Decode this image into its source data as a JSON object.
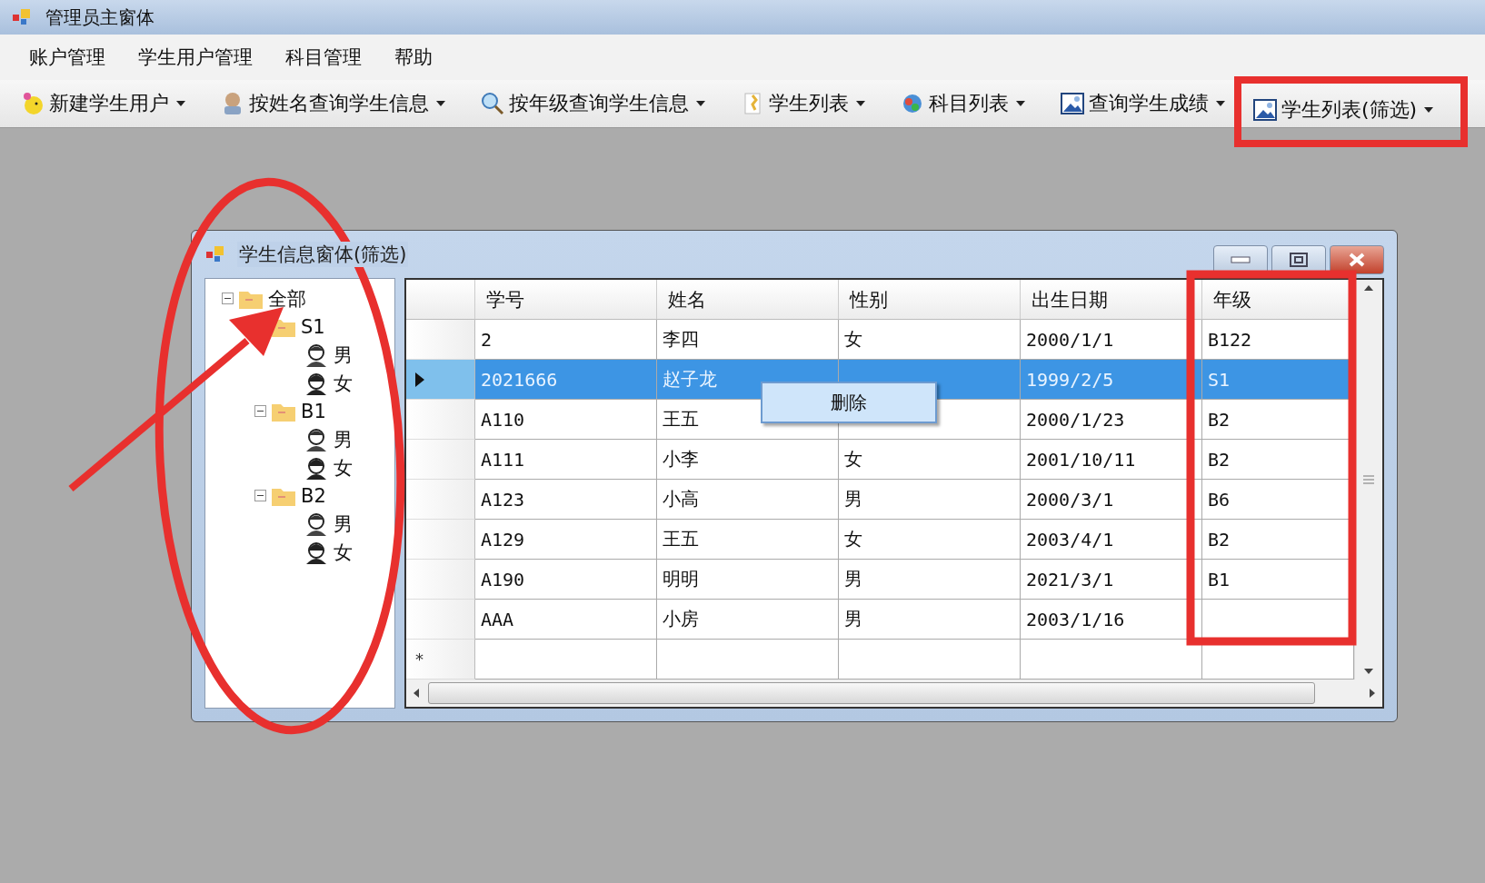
{
  "window": {
    "title": "管理员主窗体"
  },
  "menu": [
    "账户管理",
    "学生用户管理",
    "科目管理",
    "帮助"
  ],
  "toolbar": [
    {
      "label": "新建学生用户",
      "kind": "smiley"
    },
    {
      "label": "按姓名查询学生信息",
      "kind": "person"
    },
    {
      "label": "按年级查询学生信息",
      "kind": "magnifier"
    },
    {
      "label": "学生列表",
      "kind": "document"
    },
    {
      "label": "科目列表",
      "kind": "globe"
    },
    {
      "label": "查询学生成绩",
      "kind": "image"
    },
    {
      "label": "学生列表(筛选)",
      "kind": "image"
    }
  ],
  "child_window": {
    "title": "学生信息窗体(筛选)",
    "tree": [
      {
        "label": "全部",
        "kind": "folder",
        "expanded": true,
        "children": [
          {
            "label": "S1",
            "kind": "folder",
            "children": [
              {
                "label": "男",
                "kind": "male"
              },
              {
                "label": "女",
                "kind": "female"
              }
            ]
          },
          {
            "label": "B1",
            "kind": "folder",
            "expanded": true,
            "children": [
              {
                "label": "男",
                "kind": "male"
              },
              {
                "label": "女",
                "kind": "female"
              }
            ]
          },
          {
            "label": "B2",
            "kind": "folder",
            "expanded": true,
            "children": [
              {
                "label": "男",
                "kind": "male"
              },
              {
                "label": "女",
                "kind": "female"
              }
            ]
          }
        ]
      }
    ],
    "table": {
      "columns": [
        "学号",
        "姓名",
        "性别",
        "出生日期",
        "年级"
      ],
      "rows": [
        {
          "selected": false,
          "cells": [
            "2",
            "李四",
            "女",
            "2000/1/1",
            "B122"
          ]
        },
        {
          "selected": true,
          "cells": [
            "2021666",
            "赵子龙",
            null,
            "1999/2/5",
            "S1"
          ]
        },
        {
          "selected": false,
          "cells": [
            "A110",
            "王五",
            null,
            "2000/1/23",
            "B2"
          ]
        },
        {
          "selected": false,
          "cells": [
            "A111",
            "小李",
            "女",
            "2001/10/11",
            "B2"
          ]
        },
        {
          "selected": false,
          "cells": [
            "A123",
            "小高",
            "男",
            "2000/3/1",
            "B6"
          ]
        },
        {
          "selected": false,
          "cells": [
            "A129",
            "王五",
            "女",
            "2003/4/1",
            "B2"
          ]
        },
        {
          "selected": false,
          "cells": [
            "A190",
            "明明",
            "男",
            "2021/3/1",
            "B1"
          ]
        },
        {
          "selected": false,
          "cells": [
            "AAA",
            "小房",
            "男",
            "2003/1/16",
            null
          ]
        }
      ],
      "new_row_marker": "*"
    },
    "context_menu": [
      "删除"
    ]
  }
}
